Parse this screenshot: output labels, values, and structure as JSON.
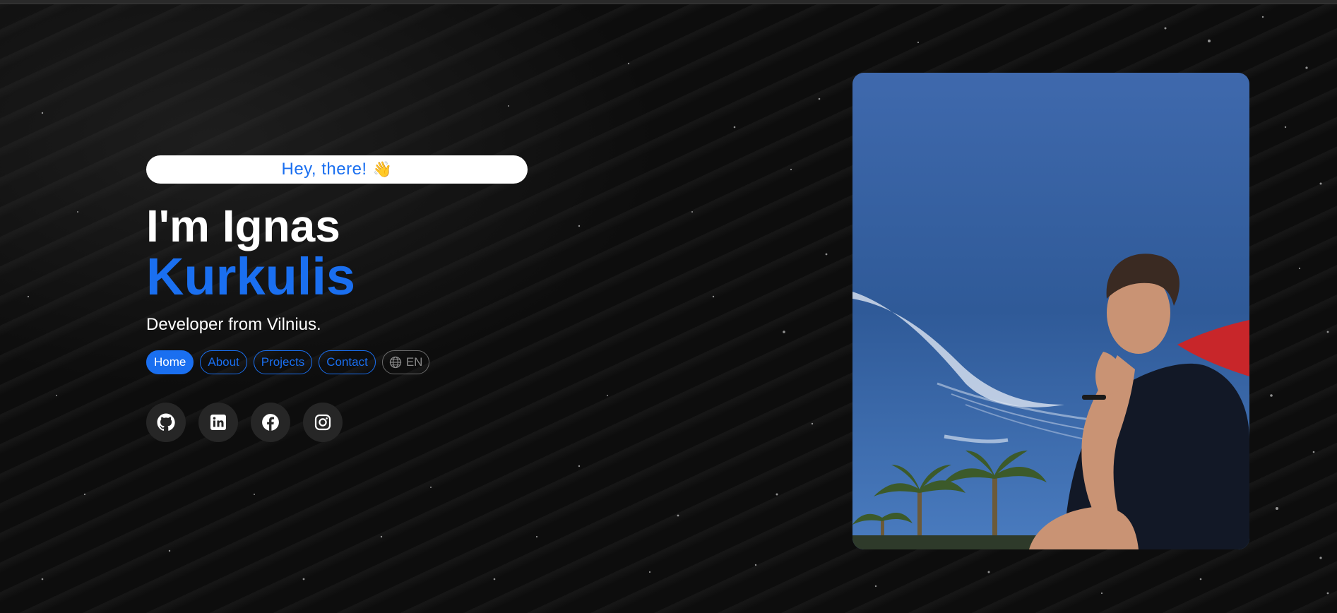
{
  "hero": {
    "greeting": "Hey, there!",
    "greeting_emoji": "👋",
    "name_first_line": "I'm Ignas",
    "name_second_line": "Kurkulis",
    "subtitle": "Developer from Vilnius."
  },
  "nav": {
    "items": [
      {
        "label": "Home",
        "active": true
      },
      {
        "label": "About",
        "active": false
      },
      {
        "label": "Projects",
        "active": false
      },
      {
        "label": "Contact",
        "active": false
      }
    ],
    "language": {
      "label": "EN",
      "icon": "globe-icon"
    }
  },
  "socials": [
    {
      "icon": "github-icon"
    },
    {
      "icon": "linkedin-icon"
    },
    {
      "icon": "facebook-icon"
    },
    {
      "icon": "instagram-icon"
    }
  ],
  "colors": {
    "accent": "#1a6ff0",
    "background": "#0d0d0d",
    "social_bg": "#262626"
  },
  "photo": {
    "subject": "portrait-photo"
  }
}
